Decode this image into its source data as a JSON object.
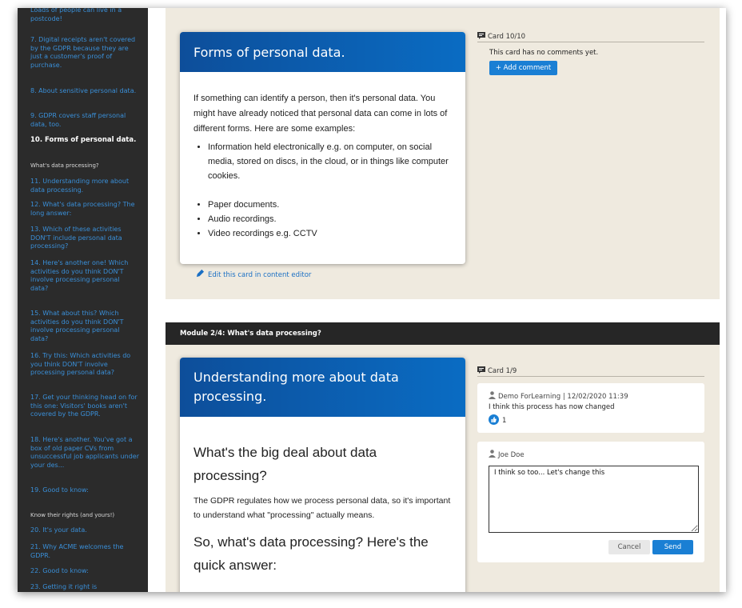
{
  "sidebar": {
    "items_top": [
      {
        "label": "Loads of people can live in a postcode!"
      },
      {
        "label": "7. Digital receipts aren't covered by the GDPR because they are just a customer's proof of purchase."
      },
      {
        "label": "8. About sensitive personal data."
      },
      {
        "label": "9. GDPR covers staff personal data, too."
      },
      {
        "label": "10. Forms of personal data."
      }
    ],
    "section2": "What's data processing?",
    "items_mid": [
      {
        "label": "11. Understanding more about data processing."
      },
      {
        "label": "12. What's data processing? The long answer:"
      },
      {
        "label": "13. Which of these activities DON'T include personal data processing?"
      },
      {
        "label": "14. Here's another one! Which activities do you think DON'T involve processing personal data?"
      },
      {
        "label": "15. What about this? Which activities do you think DON'T involve processing personal data?"
      },
      {
        "label": "16. Try this: Which activities do you think DON'T involve processing personal data?"
      },
      {
        "label": "17. Get your thinking head on for this one: Visitors' books aren't covered by the GDPR."
      },
      {
        "label": "18. Here's another. You've got a box of old paper CVs from unsuccessful job applicants under your des..."
      },
      {
        "label": "19. Good to know:"
      }
    ],
    "section3": "Know their rights (and yours!)",
    "items_bottom": [
      {
        "label": "20. It's your data."
      },
      {
        "label": "21. Why ACME welcomes the GDPR."
      },
      {
        "label": "22. Good to know:"
      },
      {
        "label": "23. Getting it right is"
      }
    ]
  },
  "card1": {
    "title": "Forms of personal data.",
    "intro": "If something can identify a person, then it's personal data. You might have already noticed that personal data can come in lots of different forms. Here are some examples:",
    "bullets_a": [
      "Information held electronically e.g. on computer, on social media, stored on discs, in the cloud, or in things like computer cookies."
    ],
    "bullets_b": [
      "Paper documents.",
      "Audio recordings.",
      "Video recordings e.g. CCTV"
    ],
    "edit_link": "Edit this card in content editor",
    "card_counter": "Card 10/10",
    "no_comments": "This card has no comments yet.",
    "add_comment": "+ Add comment"
  },
  "module": {
    "title": "Module 2/4: What's data processing?"
  },
  "card2": {
    "title": "Understanding more about data processing.",
    "heading1": "What's the big deal about data processing?",
    "para1": "The GDPR regulates how we process personal data, so it's important to understand what \"processing\" actually means.",
    "heading2": "So, what's data processing? Here's the quick answer:",
    "card_counter": "Card 1/9",
    "comment": {
      "author": "Demo ForLearning | 12/02/2020 11:39",
      "text": "I think this process has now changed",
      "likes": "1"
    },
    "reply": {
      "author": "Joe Doe",
      "value": "I think so too... Let's change this",
      "cancel": "Cancel",
      "send": "Send"
    }
  },
  "colors": {
    "sidebar_bg": "#2b2b2b",
    "link": "#3a8fd8",
    "panel_bg": "#efeadf",
    "card_header": "#0a5fb0",
    "button": "#1a7fd4"
  }
}
